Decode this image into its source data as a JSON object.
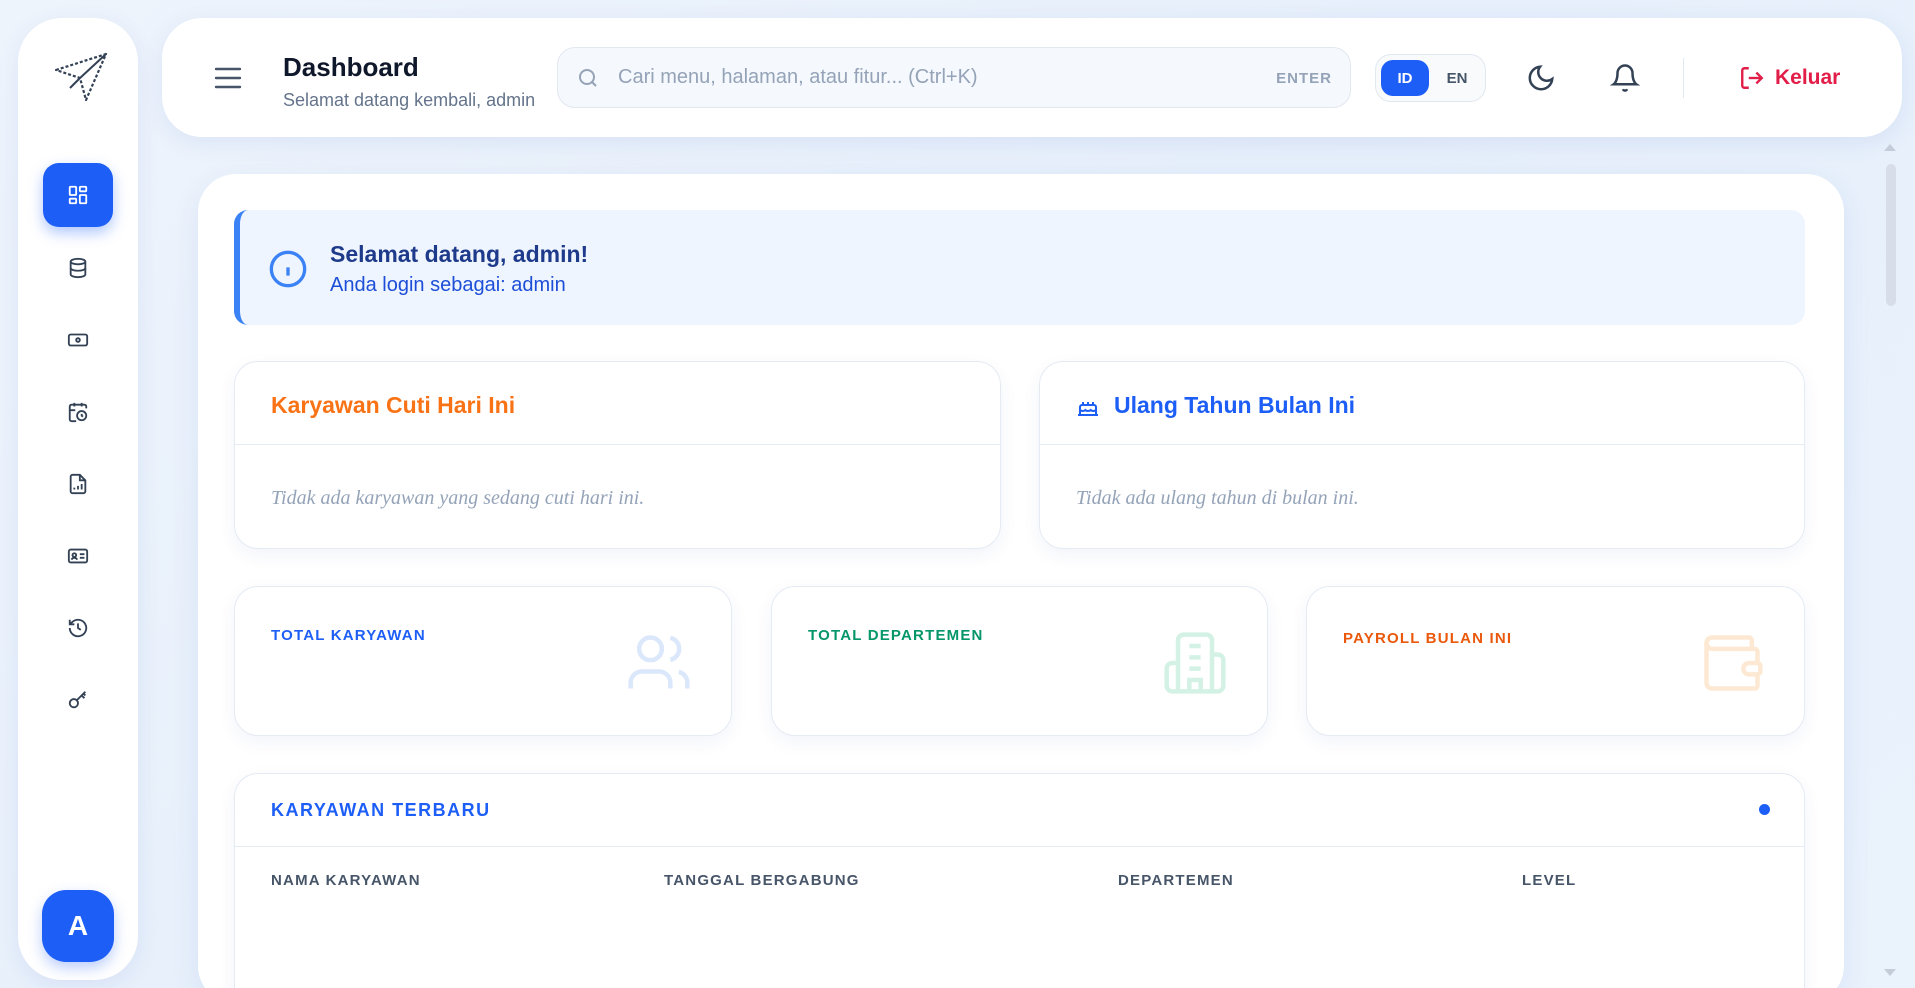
{
  "sidebar": {
    "items": [
      {
        "icon": "dashboard-icon",
        "active": true
      },
      {
        "icon": "database-icon"
      },
      {
        "icon": "payroll-icon"
      },
      {
        "icon": "calendar-clock-icon"
      },
      {
        "icon": "report-icon"
      },
      {
        "icon": "id-card-icon"
      },
      {
        "icon": "history-icon"
      },
      {
        "icon": "key-icon"
      }
    ],
    "avatar_initial": "A"
  },
  "header": {
    "title": "Dashboard",
    "subtitle": "Selamat datang kembali, admin",
    "search_placeholder": "Cari menu, halaman, atau fitur... (Ctrl+K)",
    "search_hint": "ENTER",
    "lang_id": "ID",
    "lang_en": "EN",
    "active_lang": "ID",
    "logout_label": "Keluar"
  },
  "alert": {
    "title": "Selamat datang, admin!",
    "text": "Anda login sebagai: admin"
  },
  "leave_card": {
    "title": "Karyawan Cuti Hari Ini",
    "empty": "Tidak ada karyawan yang sedang cuti hari ini."
  },
  "birthday_card": {
    "title": "Ulang Tahun Bulan Ini",
    "empty": "Tidak ada ulang tahun di bulan ini."
  },
  "stats": [
    {
      "label": "TOTAL KARYAWAN",
      "color": "#1d5ef6",
      "icon": "users-icon"
    },
    {
      "label": "TOTAL DEPARTEMEN",
      "color": "#059669",
      "icon": "building-icon"
    },
    {
      "label": "PAYROLL BULAN INI",
      "color": "#ea580c",
      "icon": "wallet-icon"
    }
  ],
  "recent_employees": {
    "title": "KARYAWAN TERBARU",
    "columns": [
      "NAMA KARYAWAN",
      "TANGGAL BERGABUNG",
      "DEPARTEMEN",
      "LEVEL"
    ]
  },
  "colors": {
    "primary": "#1d5ef6",
    "danger": "#e11d48",
    "orange": "#f97316",
    "alert_bg": "#eef5ff"
  }
}
